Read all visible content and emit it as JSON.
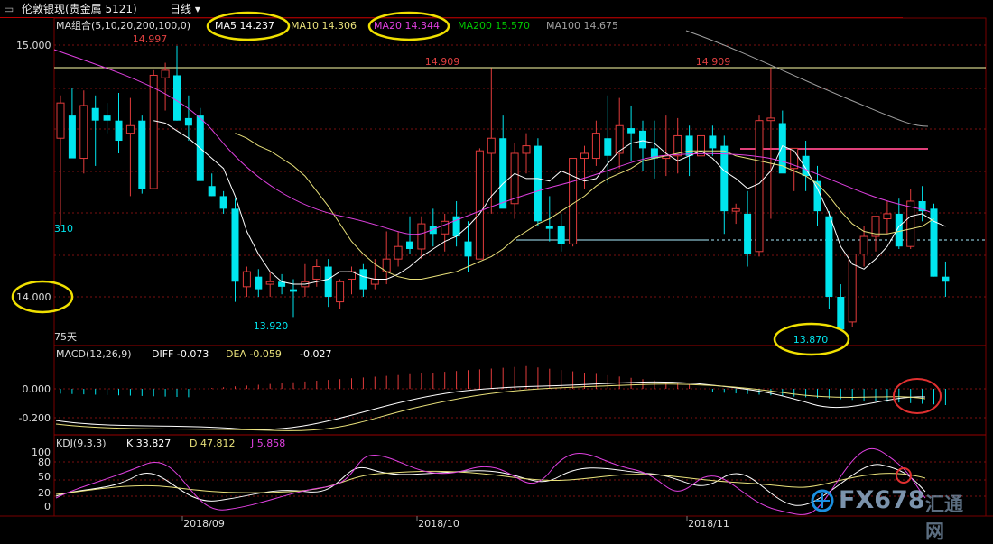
{
  "window": {
    "title": "伦敦银现(贵金属 5121)",
    "period": "日线",
    "menu_arrow": "▾"
  },
  "colors": {
    "bg": "#000000",
    "up": "#e23b3b",
    "down": "#00e5ee",
    "ma5": "#ffffff",
    "ma10": "#e8e07a",
    "ma20": "#e040e0",
    "ma200": "#00c800",
    "ma100": "#a0a0a0",
    "grid": "#7a1010",
    "hline": "#ffffa8",
    "macd_diff": "#ffffff",
    "macd_dea": "#e8e07a",
    "kdj_k": "#ffffff",
    "kdj_d": "#e8e07a",
    "kdj_j": "#e040e0",
    "circle_yellow": "#f0e000",
    "circle_red": "#e03030"
  },
  "main_panel": {
    "ma_title": "MA组合(5,10,20,200,100,0)",
    "ma_values": [
      {
        "label": "MA5",
        "value": "14.237",
        "color": "#ffffff"
      },
      {
        "label": "MA10",
        "value": "14.306",
        "color": "#e8e07a"
      },
      {
        "label": "MA20",
        "value": "14.344",
        "color": "#e040e0"
      },
      {
        "label": "MA200",
        "value": "15.570",
        "color": "#00c800"
      },
      {
        "label": "MA100",
        "value": "14.675",
        "color": "#a0a0a0"
      }
    ],
    "y_ticks": [
      "15.000",
      "14.000"
    ],
    "peak_labels": {
      "left_high": "14.997",
      "mid_high": "14.909",
      "right_high": "14.909",
      "low_left": "13.920",
      "low_right": "13.870"
    },
    "left_label": "310",
    "day_count": "75天"
  },
  "macd_panel": {
    "title": "MACD(12,26,9)",
    "diff": "DIFF -0.073",
    "dea": "DEA -0.059",
    "macd": "-0.027",
    "y_ticks": [
      "0.000",
      "-0.200"
    ]
  },
  "kdj_panel": {
    "title": "KDJ(9,3,3)",
    "k": "K 33.827",
    "d": "D 47.812",
    "j": "J 5.858",
    "y_ticks": [
      "100",
      "80",
      "50",
      "20",
      "0"
    ]
  },
  "x_axis": {
    "labels": [
      "2018/09",
      "2018/10",
      "2018/11"
    ]
  },
  "watermark": {
    "text": "FX678",
    "cn": "汇通网"
  },
  "chart_data": {
    "type": "candlestick",
    "candles_ohlc": [
      [
        14.63,
        14.8,
        14.28,
        14.77
      ],
      [
        14.72,
        14.83,
        14.56,
        14.55
      ],
      [
        14.55,
        14.82,
        14.49,
        14.76
      ],
      [
        14.75,
        14.8,
        14.52,
        14.7
      ],
      [
        14.72,
        14.77,
        14.65,
        14.7
      ],
      [
        14.7,
        14.81,
        14.57,
        14.62
      ],
      [
        14.65,
        14.79,
        14.4,
        14.68
      ],
      [
        14.7,
        14.72,
        14.41,
        14.43
      ],
      [
        14.43,
        14.9,
        14.44,
        14.88
      ],
      [
        14.87,
        14.93,
        14.74,
        14.9
      ],
      [
        14.88,
        14.997,
        14.7,
        14.7
      ],
      [
        14.71,
        14.8,
        14.62,
        14.68
      ],
      [
        14.72,
        14.75,
        14.46,
        14.46
      ],
      [
        14.44,
        14.49,
        14.4,
        14.4
      ],
      [
        14.4,
        14.42,
        14.33,
        14.35
      ],
      [
        14.35,
        14.39,
        13.98,
        14.06
      ],
      [
        14.04,
        14.12,
        14.0,
        14.1
      ],
      [
        14.08,
        14.11,
        14.0,
        14.03
      ],
      [
        14.05,
        14.1,
        14.0,
        14.06
      ],
      [
        14.06,
        14.09,
        14.01,
        14.04
      ],
      [
        14.03,
        14.07,
        13.92,
        14.02
      ],
      [
        14.04,
        14.13,
        14.0,
        14.06
      ],
      [
        14.07,
        14.15,
        14.04,
        14.12
      ],
      [
        14.12,
        14.15,
        13.96,
        14.0
      ],
      [
        13.98,
        14.07,
        13.95,
        14.06
      ],
      [
        14.07,
        14.12,
        14.01,
        14.1
      ],
      [
        14.11,
        14.13,
        14.0,
        14.03
      ],
      [
        14.05,
        14.15,
        14.03,
        14.07
      ],
      [
        14.1,
        14.26,
        14.05,
        14.15
      ],
      [
        14.15,
        14.26,
        14.12,
        14.2
      ],
      [
        14.22,
        14.32,
        14.17,
        14.19
      ],
      [
        14.19,
        14.32,
        14.15,
        14.29
      ],
      [
        14.28,
        14.35,
        14.2,
        14.25
      ],
      [
        14.25,
        14.33,
        14.18,
        14.3
      ],
      [
        14.32,
        14.38,
        14.2,
        14.24
      ],
      [
        14.22,
        14.3,
        14.1,
        14.16
      ],
      [
        14.15,
        14.59,
        14.16,
        14.58
      ],
      [
        14.57,
        14.909,
        14.33,
        14.63
      ],
      [
        14.63,
        14.72,
        14.48,
        14.35
      ],
      [
        14.37,
        14.61,
        14.31,
        14.57
      ],
      [
        14.57,
        14.65,
        14.49,
        14.6
      ],
      [
        14.6,
        14.63,
        14.28,
        14.3
      ],
      [
        14.28,
        14.4,
        14.22,
        14.27
      ],
      [
        14.28,
        14.33,
        14.18,
        14.21
      ],
      [
        14.21,
        14.55,
        14.2,
        14.55
      ],
      [
        14.55,
        14.6,
        14.43,
        14.57
      ],
      [
        14.55,
        14.7,
        14.52,
        14.65
      ],
      [
        14.63,
        14.8,
        14.45,
        14.56
      ],
      [
        14.57,
        14.79,
        14.51,
        14.68
      ],
      [
        14.67,
        14.76,
        14.54,
        14.65
      ],
      [
        14.66,
        14.7,
        14.5,
        14.59
      ],
      [
        14.59,
        14.7,
        14.47,
        14.55
      ],
      [
        14.55,
        14.72,
        14.48,
        14.56
      ],
      [
        14.56,
        14.71,
        14.49,
        14.64
      ],
      [
        14.64,
        14.68,
        14.48,
        14.56
      ],
      [
        14.56,
        14.7,
        14.49,
        14.64
      ],
      [
        14.64,
        14.68,
        14.56,
        14.59
      ],
      [
        14.6,
        14.64,
        14.25,
        14.34
      ],
      [
        14.34,
        14.37,
        14.29,
        14.35
      ],
      [
        14.33,
        14.42,
        14.12,
        14.17
      ],
      [
        14.18,
        14.72,
        14.16,
        14.7
      ],
      [
        14.7,
        14.909,
        14.31,
        14.71
      ],
      [
        14.69,
        14.74,
        14.55,
        14.49
      ],
      [
        14.51,
        14.56,
        14.42,
        14.59
      ],
      [
        14.56,
        14.62,
        14.42,
        14.48
      ],
      [
        14.46,
        14.52,
        14.28,
        14.34
      ],
      [
        14.32,
        14.34,
        13.95,
        14.0
      ],
      [
        14.0,
        14.05,
        13.87,
        13.87
      ],
      [
        13.9,
        14.17,
        13.88,
        14.17
      ],
      [
        14.17,
        14.28,
        14.12,
        14.24
      ],
      [
        14.24,
        14.32,
        14.18,
        14.32
      ],
      [
        14.31,
        14.38,
        14.25,
        14.33
      ],
      [
        14.33,
        14.39,
        14.19,
        14.2
      ],
      [
        14.2,
        14.43,
        14.19,
        14.38
      ],
      [
        14.38,
        14.44,
        14.3,
        14.34
      ],
      [
        14.35,
        14.37,
        14.08,
        14.08
      ],
      [
        14.08,
        14.14,
        14.0,
        14.06
      ]
    ],
    "ma5": [
      14.7,
      14.69,
      14.66,
      14.63,
      14.59,
      14.55,
      14.51,
      14.4,
      14.26,
      14.17,
      14.1,
      14.06,
      14.05,
      14.05,
      14.06,
      14.07,
      14.1,
      14.1,
      14.08,
      14.07,
      14.07,
      14.09,
      14.12,
      14.16,
      14.19,
      14.22,
      14.24,
      14.28,
      14.33,
      14.4,
      14.45,
      14.49,
      14.47,
      14.47,
      14.46,
      14.5,
      14.48,
      14.46,
      14.47,
      14.53,
      14.58,
      14.61,
      14.62,
      14.61,
      14.57,
      14.54,
      14.56,
      14.58,
      14.55,
      14.5,
      14.47,
      14.43,
      14.45,
      14.5,
      14.6,
      14.58,
      14.51,
      14.43,
      14.33,
      14.2,
      14.13,
      14.11,
      14.15,
      14.2,
      14.28,
      14.32,
      14.33,
      14.3,
      14.28
    ],
    "ma10": [
      14.65,
      14.63,
      14.6,
      14.58,
      14.55,
      14.52,
      14.48,
      14.42,
      14.36,
      14.29,
      14.22,
      14.17,
      14.13,
      14.1,
      14.08,
      14.07,
      14.07,
      14.08,
      14.09,
      14.1,
      14.12,
      14.14,
      14.16,
      14.19,
      14.23,
      14.26,
      14.29,
      14.31,
      14.34,
      14.37,
      14.4,
      14.44,
      14.47,
      14.49,
      14.51,
      14.54,
      14.55,
      14.56,
      14.57,
      14.58,
      14.58,
      14.58,
      14.58,
      14.56,
      14.55,
      14.54,
      14.53,
      14.52,
      14.5,
      14.48,
      14.45,
      14.4,
      14.34,
      14.29,
      14.26,
      14.25,
      14.25,
      14.26,
      14.27,
      14.28,
      14.31
    ]
  }
}
